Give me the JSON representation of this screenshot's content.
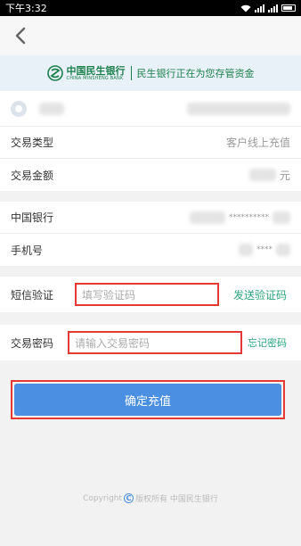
{
  "status_bar": {
    "time": "下午3:32"
  },
  "banner": {
    "bank_name_cn": "中国民生银行",
    "bank_name_en": "CHINA MINSHENG BANK",
    "message": "民生银行正在为您存管资金"
  },
  "transaction": {
    "type_label": "交易类型",
    "type_value": "客户线上充值",
    "amount_label": "交易金额",
    "amount_unit": "元"
  },
  "account": {
    "bank_label": "中国银行",
    "bank_value": "**********",
    "phone_label": "手机号",
    "phone_value": "****"
  },
  "sms": {
    "label": "短信验证",
    "placeholder": "填写验证码",
    "send_label": "发送验证码"
  },
  "password": {
    "label": "交易密码",
    "placeholder": "请输入交易密码",
    "forgot_label": "忘记密码"
  },
  "confirm_label": "确定充值",
  "footer": {
    "prefix": "Copyright",
    "text": "版权所有 中国民生银行"
  },
  "colors": {
    "accent_button": "#4a8fe2",
    "brand_green": "#1a7f4a",
    "link_green": "#2aa57a",
    "highlight_red": "#e53935"
  }
}
